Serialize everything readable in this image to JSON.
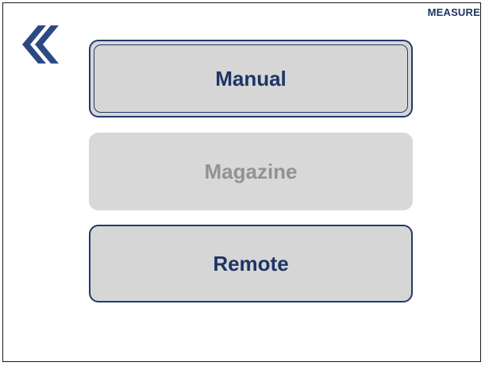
{
  "header": {
    "title": "MEASURE",
    "back_icon": "double-chevron-left-icon"
  },
  "colors": {
    "accent": "#1e3565",
    "button_bg": "#d6d6d6",
    "disabled_text": "#929292"
  },
  "menu": {
    "manual_label": "Manual",
    "magazine_label": "Magazine",
    "remote_label": "Remote"
  }
}
